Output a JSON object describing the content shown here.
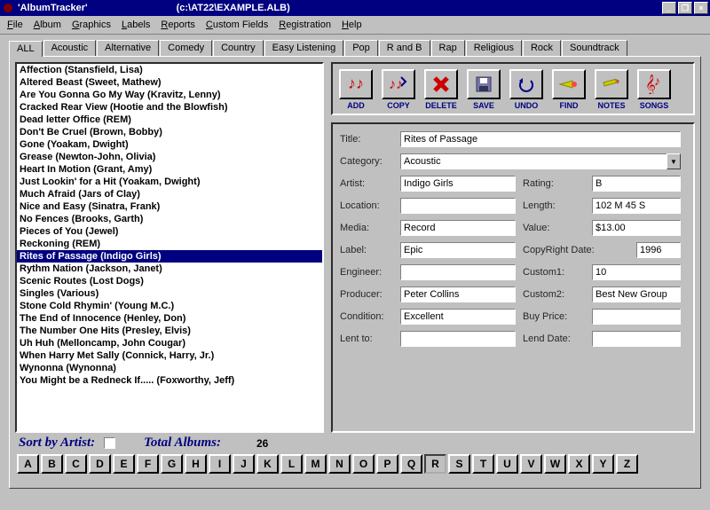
{
  "window": {
    "title": "'AlbumTracker'",
    "path": "(c:\\AT22\\EXAMPLE.ALB)"
  },
  "menus": [
    "File",
    "Album",
    "Graphics",
    "Labels",
    "Reports",
    "Custom Fields",
    "Registration",
    "Help"
  ],
  "tabs": [
    "ALL",
    "Acoustic",
    "Alternative",
    "Comedy",
    "Country",
    "Easy Listening",
    "Pop",
    "R and B",
    "Rap",
    "Religious",
    "Rock",
    "Soundtrack"
  ],
  "active_tab": 0,
  "albums": [
    "Affection (Stansfield, Lisa)",
    "Altered Beast (Sweet, Mathew)",
    "Are You Gonna Go My Way (Kravitz, Lenny)",
    "Cracked Rear View (Hootie and the Blowfish)",
    "Dead letter Office (REM)",
    "Don't Be Cruel (Brown, Bobby)",
    "Gone (Yoakam, Dwight)",
    "Grease (Newton-John, Olivia)",
    "Heart In Motion (Grant, Amy)",
    "Just Lookin' for a Hit (Yoakam, Dwight)",
    "Much Afraid (Jars of Clay)",
    "Nice and Easy (Sinatra, Frank)",
    "No Fences (Brooks, Garth)",
    "Pieces of You (Jewel)",
    "Reckoning (REM)",
    "Rites of Passage (Indigo Girls)",
    "Rythm Nation (Jackson, Janet)",
    "Scenic Routes (Lost Dogs)",
    "Singles (Various)",
    "Stone Cold Rhymin' (Young M.C.)",
    "The End of Innocence (Henley, Don)",
    "The Number One Hits (Presley, Elvis)",
    "Uh Huh (Melloncamp, John Cougar)",
    "When Harry Met Sally (Connick, Harry, Jr.)",
    "Wynonna (Wynonna)",
    "You Might be a Redneck If..... (Foxworthy, Jeff)"
  ],
  "selected_index": 15,
  "toolbar": [
    {
      "label": "ADD",
      "icon": "notes-plus"
    },
    {
      "label": "COPY",
      "icon": "notes-copy"
    },
    {
      "label": "DELETE",
      "icon": "x"
    },
    {
      "label": "SAVE",
      "icon": "disk"
    },
    {
      "label": "UNDO",
      "icon": "undo"
    },
    {
      "label": "FIND",
      "icon": "find"
    },
    {
      "label": "NOTES",
      "icon": "pencil"
    },
    {
      "label": "SONGS",
      "icon": "clef"
    }
  ],
  "form": {
    "labels": {
      "title": "Title:",
      "category": "Category:",
      "artist": "Artist:",
      "rating": "Rating:",
      "location": "Location:",
      "length": "Length:",
      "media": "Media:",
      "value": "Value:",
      "label": "Label:",
      "copyright": "CopyRight Date:",
      "engineer": "Engineer:",
      "custom1": "Custom1:",
      "producer": "Producer:",
      "custom2": "Custom2:",
      "condition": "Condition:",
      "buyprice": "Buy Price:",
      "lentto": "Lent to:",
      "lenddate": "Lend Date:"
    },
    "values": {
      "title": "Rites of Passage",
      "category": "Acoustic",
      "artist": "Indigo Girls",
      "rating": "B",
      "location": "",
      "length": "102 M 45 S",
      "media": "Record",
      "value": "$13.00",
      "label": "Epic",
      "copyright": "1996",
      "engineer": "",
      "custom1": "10",
      "producer": "Peter Collins",
      "custom2": "Best New Group",
      "condition": "Excellent",
      "buyprice": "",
      "lentto": "",
      "lenddate": ""
    }
  },
  "footer": {
    "sort_label": "Sort by Artist:",
    "total_label": "Total Albums:",
    "total_count": "26"
  },
  "alpha": [
    "A",
    "B",
    "C",
    "D",
    "E",
    "F",
    "G",
    "H",
    "I",
    "J",
    "K",
    "L",
    "M",
    "N",
    "O",
    "P",
    "Q",
    "R",
    "S",
    "T",
    "U",
    "V",
    "W",
    "X",
    "Y",
    "Z"
  ],
  "alpha_pressed": 17
}
